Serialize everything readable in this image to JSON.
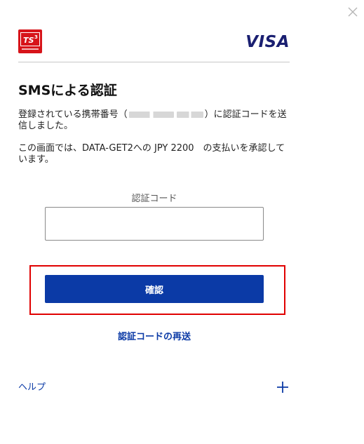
{
  "header": {
    "ts_logo_text": "TS3",
    "card_brand": "VISA",
    "close_icon": "close-icon"
  },
  "main": {
    "title": "SMSによる認証",
    "message1_before": "登録されている携帯番号（",
    "message1_after": "）に認証コードを送信しました。",
    "message2": "この画面では、DATA-GET2への JPY 2200　の支払いを承認しています。",
    "code_label": "認証コード",
    "code_value": "",
    "confirm_label": "確認",
    "resend_label": "認証コードの再送",
    "help_label": "ヘルプ",
    "help_icon": "plus-icon"
  },
  "colors": {
    "primary": "#0b3aa6",
    "highlight": "#e00000",
    "visa": "#1a1f71",
    "ts_logo": "#d7141a"
  }
}
